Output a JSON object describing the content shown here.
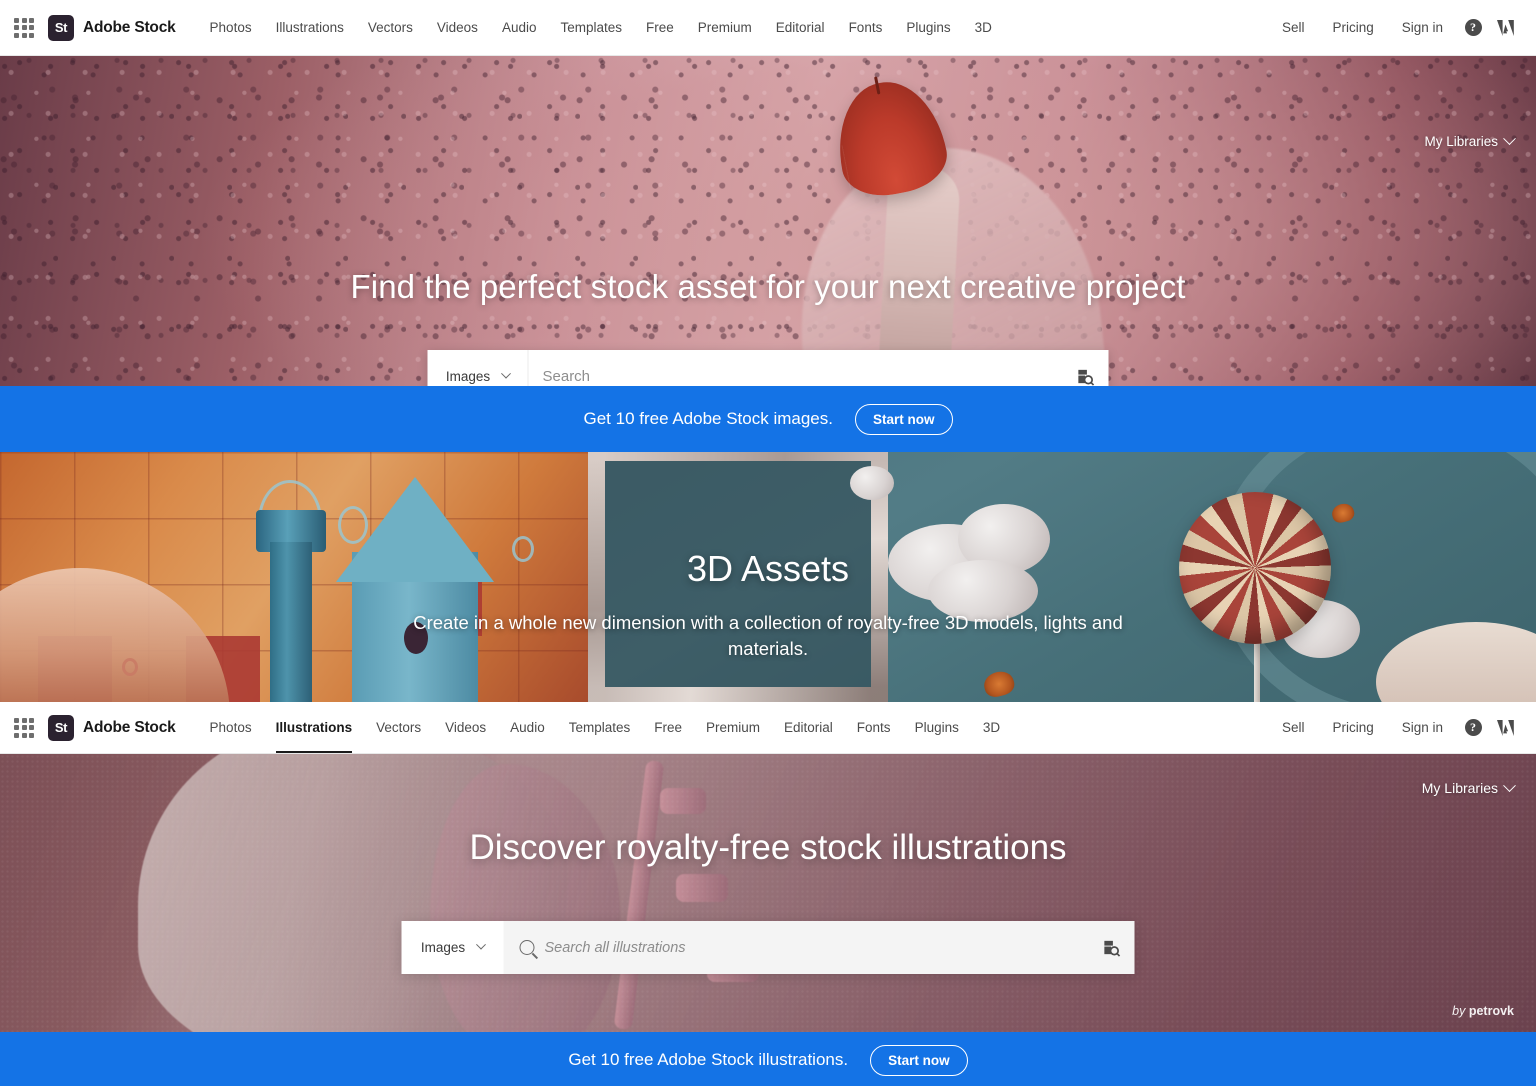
{
  "brand": {
    "mark": "St",
    "name": "Adobe Stock",
    "app_grid_icon": "app-grid-icon"
  },
  "nav_primary": {
    "items": [
      {
        "label": "Photos",
        "active": false
      },
      {
        "label": "Illustrations",
        "active": false
      },
      {
        "label": "Vectors",
        "active": false
      },
      {
        "label": "Videos",
        "active": false
      },
      {
        "label": "Audio",
        "active": false
      },
      {
        "label": "Templates",
        "active": false
      },
      {
        "label": "Free",
        "active": false
      },
      {
        "label": "Premium",
        "active": false
      },
      {
        "label": "Editorial",
        "active": false
      },
      {
        "label": "Fonts",
        "active": false
      },
      {
        "label": "Plugins",
        "active": false
      },
      {
        "label": "3D",
        "active": false
      }
    ],
    "right": {
      "sell": "Sell",
      "pricing": "Pricing",
      "signin": "Sign in",
      "help_icon": "help-circle-icon",
      "help_glyph": "?",
      "adobe_icon": "adobe-logo-icon"
    }
  },
  "nav_secondary": {
    "items": [
      {
        "label": "Photos",
        "active": false
      },
      {
        "label": "Illustrations",
        "active": true
      },
      {
        "label": "Vectors",
        "active": false
      },
      {
        "label": "Videos",
        "active": false
      },
      {
        "label": "Audio",
        "active": false
      },
      {
        "label": "Templates",
        "active": false
      },
      {
        "label": "Free",
        "active": false
      },
      {
        "label": "Premium",
        "active": false
      },
      {
        "label": "Editorial",
        "active": false
      },
      {
        "label": "Fonts",
        "active": false
      },
      {
        "label": "Plugins",
        "active": false
      },
      {
        "label": "3D",
        "active": false
      }
    ],
    "right": {
      "sell": "Sell",
      "pricing": "Pricing",
      "signin": "Sign in",
      "help_glyph": "?"
    }
  },
  "hero_photos": {
    "title": "Find the perfect stock asset for your next creative project",
    "my_libraries": "My Libraries",
    "search": {
      "type_label": "Images",
      "placeholder": "Search",
      "value": "",
      "visual_search_icon": "visual-search-icon"
    }
  },
  "promo_top": {
    "text": "Get 10 free Adobe Stock images.",
    "button": "Start now",
    "background": "#1473e6"
  },
  "banner_3d": {
    "title": "3D Assets",
    "subtitle": "Create in a whole new dimension with a collection of royalty-free 3D models, lights and materials.",
    "left_accent": "#d98a4a",
    "right_accent": "#4d7580"
  },
  "hero_illustrations": {
    "title": "Discover royalty-free stock illustrations",
    "my_libraries": "My Libraries",
    "attribution_prefix": "by",
    "attribution_author": "petrovk",
    "search": {
      "type_label": "Images",
      "placeholder": "Search all illustrations",
      "value": "",
      "search_icon": "magnifier-icon",
      "visual_search_icon": "visual-search-icon"
    }
  },
  "promo_bottom": {
    "text": "Get 10 free Adobe Stock illustrations.",
    "button": "Start now",
    "background": "#1473e6"
  }
}
